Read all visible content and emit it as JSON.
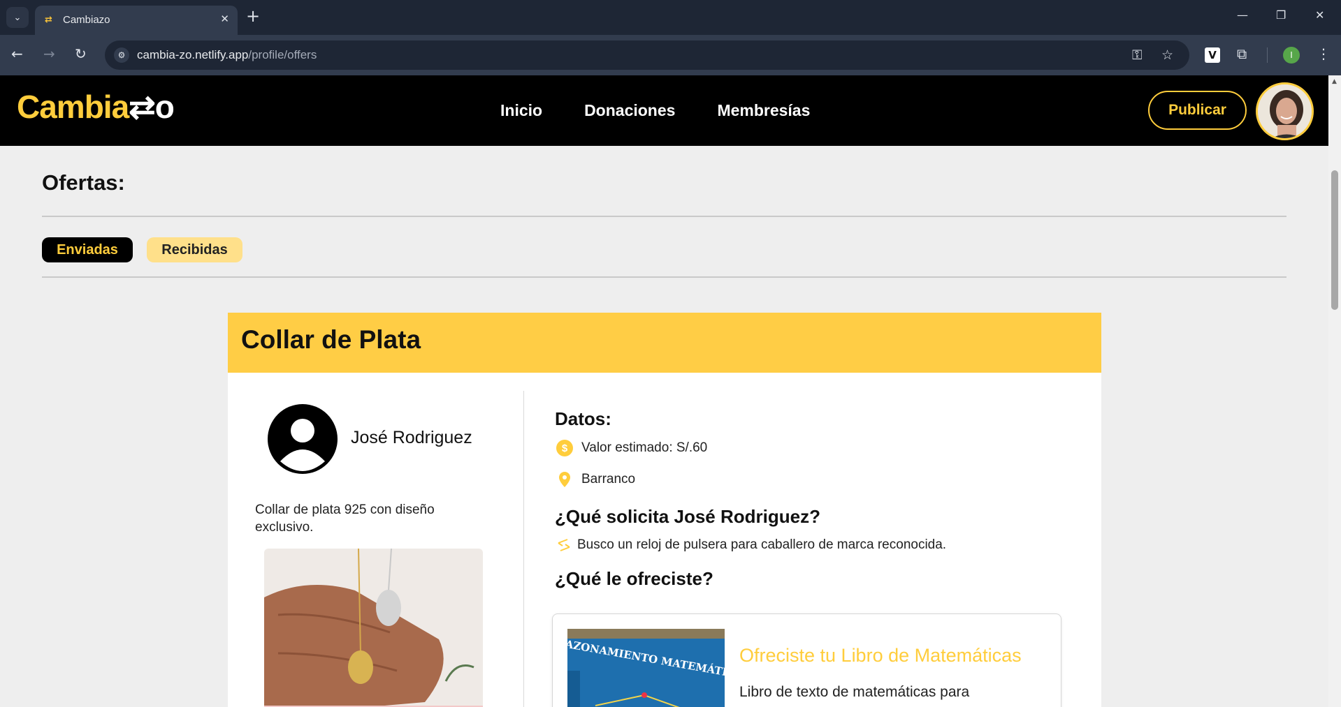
{
  "browser": {
    "tab_title": "Cambiazo",
    "url_host": "cambia-zo.netlify.app",
    "url_path": "/profile/offers",
    "profile_initial": "I"
  },
  "site": {
    "logo_main": "Cambia",
    "logo_tail": "⇄o",
    "nav": [
      "Inicio",
      "Donaciones",
      "Membresías"
    ],
    "publish_label": "Publicar"
  },
  "page": {
    "title": "Ofertas:",
    "tabs": [
      {
        "label": "Enviadas",
        "active": true
      },
      {
        "label": "Recibidas",
        "active": false
      }
    ]
  },
  "product": {
    "title": "Collar de Plata",
    "owner_name": "José Rodriguez",
    "description": "Collar de plata 925 con diseño exclusivo.",
    "data_heading": "Datos:",
    "estimated_value": "Valor estimado: S/.60",
    "location": "Barranco",
    "request_heading": "¿Qué solicita José Rodriguez?",
    "request_text": "Busco un reloj de pulsera para caballero de marca reconocida.",
    "offered_heading": "¿Qué le ofreciste?"
  },
  "offer": {
    "title": "Ofreciste tu Libro de Matemáticas",
    "description": "Libro de texto de matemáticas para",
    "book_cover_text": "RAZONAMIENTO MATEMÁTICO"
  },
  "colors": {
    "brand_yellow": "#ffcd3c",
    "header_black": "#000000",
    "page_bg": "#eeeeee"
  }
}
